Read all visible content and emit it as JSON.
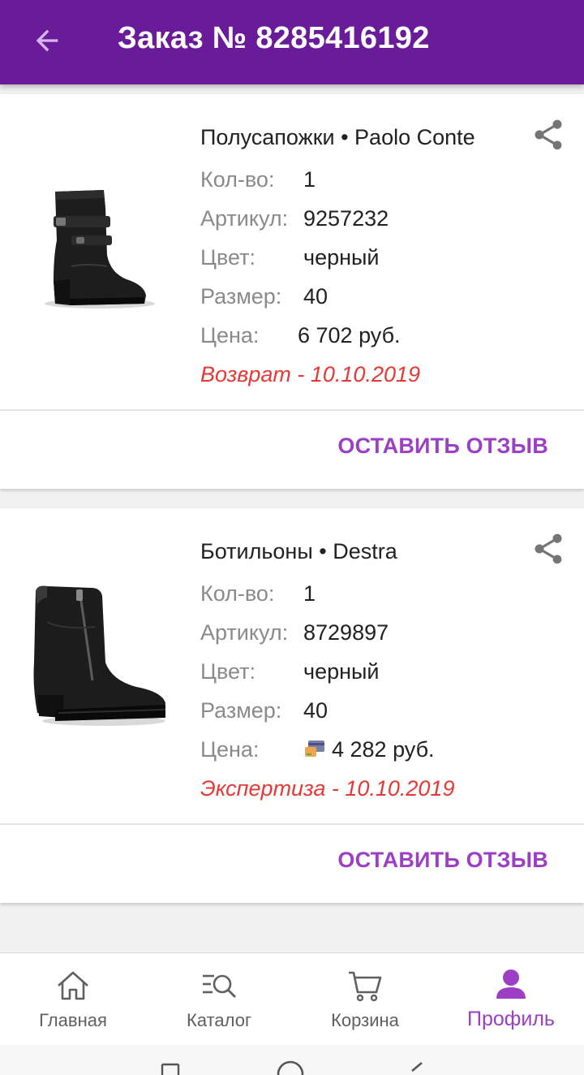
{
  "header": {
    "title": "Заказ № 8285416192"
  },
  "items": [
    {
      "title": "Полусапожки • Paolo Conte",
      "qty_label": "Кол-во:",
      "qty": "1",
      "article_label": "Артикул:",
      "article": "9257232",
      "color_label": "Цвет:",
      "color": "черный",
      "size_label": "Размер:",
      "size": "40",
      "price_label": "Цена:",
      "price": "6 702 руб.",
      "status": "Возврат - 10.10.2019",
      "review_label": "ОСТАВИТЬ ОТЗЫВ"
    },
    {
      "title": "Ботильоны • Destra",
      "qty_label": "Кол-во:",
      "qty": "1",
      "article_label": "Артикул:",
      "article": "8729897",
      "color_label": "Цвет:",
      "color": "черный",
      "size_label": "Размер:",
      "size": "40",
      "price_label": "Цена:",
      "price": "4 282 руб.",
      "status": "Экспертиза - 10.10.2019",
      "review_label": "ОСТАВИТЬ ОТЗЫВ"
    }
  ],
  "bottom_nav": [
    {
      "label": "Главная",
      "icon": "home-icon",
      "active": false
    },
    {
      "label": "Каталог",
      "icon": "catalog-search-icon",
      "active": false
    },
    {
      "label": "Корзина",
      "icon": "cart-icon",
      "active": false
    },
    {
      "label": "Профиль",
      "icon": "profile-icon",
      "active": true
    }
  ],
  "colors": {
    "header_bg": "#6a1b9a",
    "accent": "#9c3fc4",
    "status_red": "#e53935",
    "label_gray": "#8a8a8a"
  }
}
